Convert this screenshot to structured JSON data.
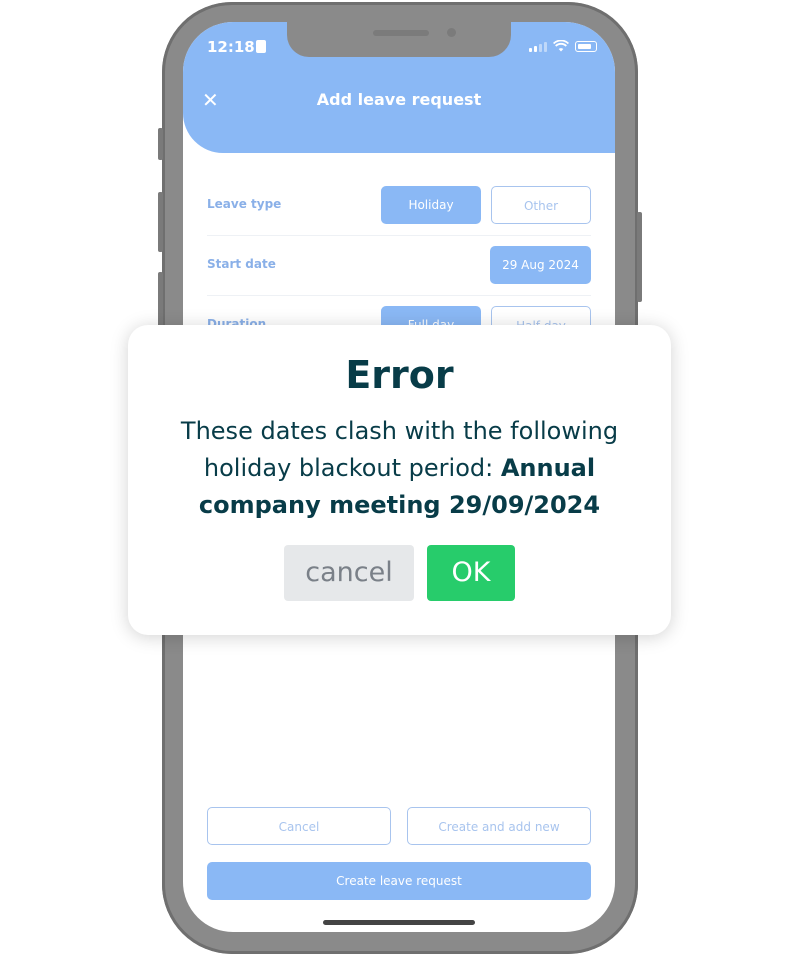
{
  "status_bar": {
    "time": "12:18"
  },
  "screen": {
    "title": "Add leave request",
    "close_icon": "close-icon"
  },
  "form": {
    "leave_type": {
      "label": "Leave type",
      "options": [
        "Holiday",
        "Other"
      ],
      "selected": "Holiday"
    },
    "start_date": {
      "label": "Start date",
      "value": "29 Aug 2024"
    },
    "duration": {
      "label": "Duration",
      "options": [
        "Full day",
        "Half day"
      ],
      "selected": "Full day"
    }
  },
  "footer": {
    "cancel_label": "Cancel",
    "create_add_new_label": "Create and add new",
    "create_label": "Create leave request"
  },
  "dialog": {
    "title": "Error",
    "message_prefix": "These dates clash with the following holiday blackout period: ",
    "message_bold": "Annual company meeting 29/09/2024",
    "cancel_label": "cancel",
    "ok_label": "OK"
  },
  "colors": {
    "accent": "#8ab8f5",
    "ok_green": "#27cc6b",
    "dialog_text": "#083c48"
  }
}
